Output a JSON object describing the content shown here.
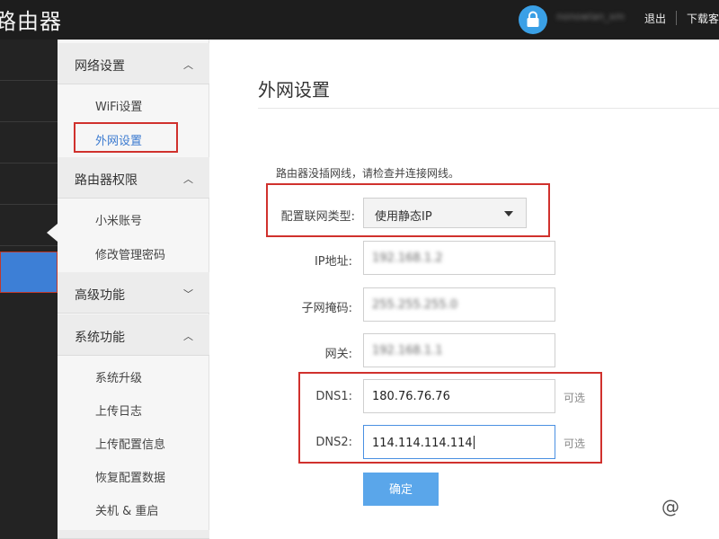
{
  "header": {
    "app_title": "路由器",
    "username": "nonowlan_xm",
    "logout_label": "退出",
    "download_label": "下载客"
  },
  "sidebar": {
    "sections": [
      {
        "label": "网络设置",
        "chevron": "up",
        "items": [
          {
            "label": "WiFi设置",
            "active": false
          },
          {
            "label": "外网设置",
            "active": true
          }
        ]
      },
      {
        "label": "路由器权限",
        "chevron": "up",
        "items": [
          {
            "label": "小米账号",
            "active": false
          },
          {
            "label": "修改管理密码",
            "active": false
          }
        ]
      },
      {
        "label": "高级功能",
        "chevron": "down",
        "items": []
      },
      {
        "label": "系统功能",
        "chevron": "up",
        "items": [
          {
            "label": "系统升级",
            "active": false
          },
          {
            "label": "上传日志",
            "active": false
          },
          {
            "label": "上传配置信息",
            "active": false
          },
          {
            "label": "恢复配置数据",
            "active": false
          },
          {
            "label": "关机 & 重启",
            "active": false
          }
        ]
      }
    ]
  },
  "main": {
    "title": "外网设置",
    "notice": "路由器没插网线，请检查并连接网线。",
    "connection_type": {
      "label": "配置联网类型:",
      "value": "使用静态IP"
    },
    "ip": {
      "label": "IP地址:",
      "value": "192.168.1.2"
    },
    "subnet": {
      "label": "子网掩码:",
      "value": "255.255.255.0"
    },
    "gateway": {
      "label": "网关:",
      "value": "192.168.1.1"
    },
    "dns1": {
      "label": "DNS1:",
      "value": "180.76.76.76",
      "optional": "可选"
    },
    "dns2": {
      "label": "DNS2:",
      "value": "114.114.114.114",
      "optional": "可选"
    },
    "submit_label": "确定"
  },
  "watermark": "@",
  "colors": {
    "accent": "#3d7fd6",
    "highlight": "#d0312d",
    "button": "#5aa6ea",
    "topbar": "#1d1d1d"
  }
}
